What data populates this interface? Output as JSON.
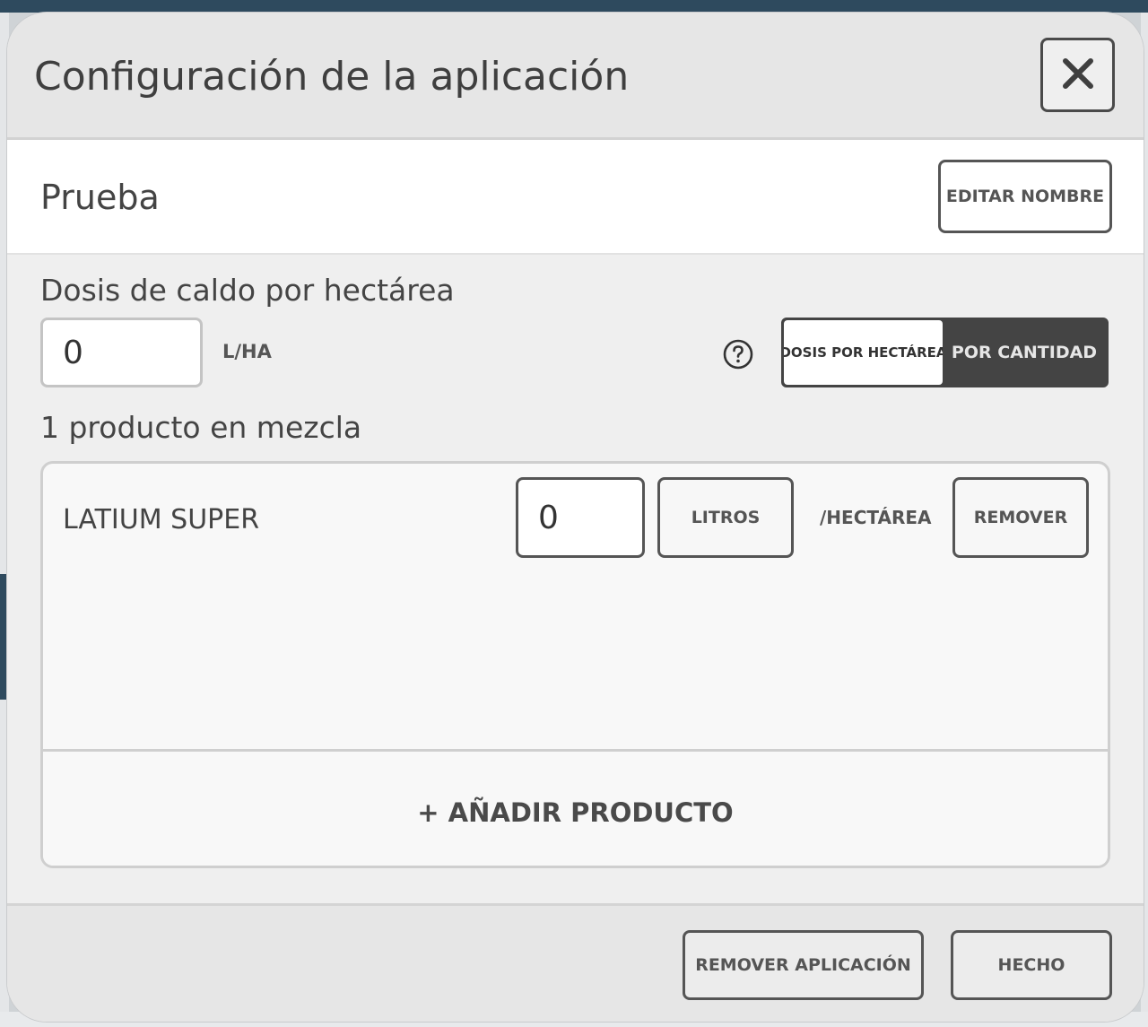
{
  "modal": {
    "title": "Configuración de la aplicación",
    "close_icon": "close-icon"
  },
  "application": {
    "name": "Prueba",
    "edit_name_label": "EDITAR NOMBRE"
  },
  "dose": {
    "label": "Dosis de caldo por hectárea",
    "value": "0",
    "unit": "L/HA",
    "help_icon": "help-circle-icon",
    "toggle": {
      "option_a": "DOSIS POR HECTÁREA",
      "option_b": "POR CANTIDAD",
      "selected": "POR CANTIDAD"
    }
  },
  "mix": {
    "label": "1 producto en mezcla",
    "products": [
      {
        "name": "LATIUM SUPER",
        "quantity": "0",
        "unit_label": "LITROS",
        "per_label": "/HECTÁREA",
        "remove_label": "REMOVER"
      }
    ],
    "add_label": "+ AÑADIR PRODUCTO"
  },
  "footer": {
    "remove_app_label": "REMOVER APLICACIÓN",
    "done_label": "HECHO"
  },
  "colors": {
    "dark": "#444444",
    "header_bg": "#e6e6e6",
    "body_bg": "#efefef",
    "app_bar": "#2e4a5e"
  }
}
